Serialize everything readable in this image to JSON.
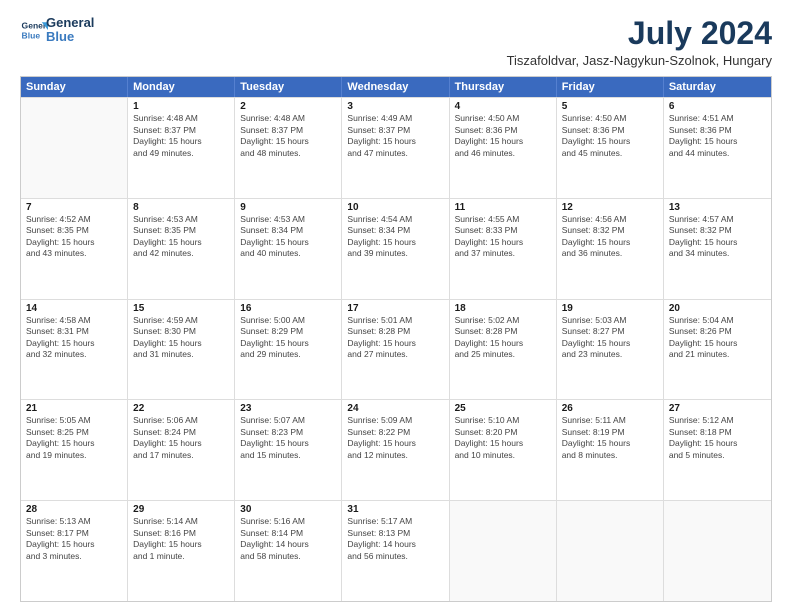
{
  "header": {
    "logo_line1": "General",
    "logo_line2": "Blue",
    "title": "July 2024",
    "subtitle": "Tiszafoldvar, Jasz-Nagykun-Szolnok, Hungary"
  },
  "weekdays": [
    "Sunday",
    "Monday",
    "Tuesday",
    "Wednesday",
    "Thursday",
    "Friday",
    "Saturday"
  ],
  "rows": [
    [
      {
        "day": "",
        "info": ""
      },
      {
        "day": "1",
        "info": "Sunrise: 4:48 AM\nSunset: 8:37 PM\nDaylight: 15 hours\nand 49 minutes."
      },
      {
        "day": "2",
        "info": "Sunrise: 4:48 AM\nSunset: 8:37 PM\nDaylight: 15 hours\nand 48 minutes."
      },
      {
        "day": "3",
        "info": "Sunrise: 4:49 AM\nSunset: 8:37 PM\nDaylight: 15 hours\nand 47 minutes."
      },
      {
        "day": "4",
        "info": "Sunrise: 4:50 AM\nSunset: 8:36 PM\nDaylight: 15 hours\nand 46 minutes."
      },
      {
        "day": "5",
        "info": "Sunrise: 4:50 AM\nSunset: 8:36 PM\nDaylight: 15 hours\nand 45 minutes."
      },
      {
        "day": "6",
        "info": "Sunrise: 4:51 AM\nSunset: 8:36 PM\nDaylight: 15 hours\nand 44 minutes."
      }
    ],
    [
      {
        "day": "7",
        "info": "Sunrise: 4:52 AM\nSunset: 8:35 PM\nDaylight: 15 hours\nand 43 minutes."
      },
      {
        "day": "8",
        "info": "Sunrise: 4:53 AM\nSunset: 8:35 PM\nDaylight: 15 hours\nand 42 minutes."
      },
      {
        "day": "9",
        "info": "Sunrise: 4:53 AM\nSunset: 8:34 PM\nDaylight: 15 hours\nand 40 minutes."
      },
      {
        "day": "10",
        "info": "Sunrise: 4:54 AM\nSunset: 8:34 PM\nDaylight: 15 hours\nand 39 minutes."
      },
      {
        "day": "11",
        "info": "Sunrise: 4:55 AM\nSunset: 8:33 PM\nDaylight: 15 hours\nand 37 minutes."
      },
      {
        "day": "12",
        "info": "Sunrise: 4:56 AM\nSunset: 8:32 PM\nDaylight: 15 hours\nand 36 minutes."
      },
      {
        "day": "13",
        "info": "Sunrise: 4:57 AM\nSunset: 8:32 PM\nDaylight: 15 hours\nand 34 minutes."
      }
    ],
    [
      {
        "day": "14",
        "info": "Sunrise: 4:58 AM\nSunset: 8:31 PM\nDaylight: 15 hours\nand 32 minutes."
      },
      {
        "day": "15",
        "info": "Sunrise: 4:59 AM\nSunset: 8:30 PM\nDaylight: 15 hours\nand 31 minutes."
      },
      {
        "day": "16",
        "info": "Sunrise: 5:00 AM\nSunset: 8:29 PM\nDaylight: 15 hours\nand 29 minutes."
      },
      {
        "day": "17",
        "info": "Sunrise: 5:01 AM\nSunset: 8:28 PM\nDaylight: 15 hours\nand 27 minutes."
      },
      {
        "day": "18",
        "info": "Sunrise: 5:02 AM\nSunset: 8:28 PM\nDaylight: 15 hours\nand 25 minutes."
      },
      {
        "day": "19",
        "info": "Sunrise: 5:03 AM\nSunset: 8:27 PM\nDaylight: 15 hours\nand 23 minutes."
      },
      {
        "day": "20",
        "info": "Sunrise: 5:04 AM\nSunset: 8:26 PM\nDaylight: 15 hours\nand 21 minutes."
      }
    ],
    [
      {
        "day": "21",
        "info": "Sunrise: 5:05 AM\nSunset: 8:25 PM\nDaylight: 15 hours\nand 19 minutes."
      },
      {
        "day": "22",
        "info": "Sunrise: 5:06 AM\nSunset: 8:24 PM\nDaylight: 15 hours\nand 17 minutes."
      },
      {
        "day": "23",
        "info": "Sunrise: 5:07 AM\nSunset: 8:23 PM\nDaylight: 15 hours\nand 15 minutes."
      },
      {
        "day": "24",
        "info": "Sunrise: 5:09 AM\nSunset: 8:22 PM\nDaylight: 15 hours\nand 12 minutes."
      },
      {
        "day": "25",
        "info": "Sunrise: 5:10 AM\nSunset: 8:20 PM\nDaylight: 15 hours\nand 10 minutes."
      },
      {
        "day": "26",
        "info": "Sunrise: 5:11 AM\nSunset: 8:19 PM\nDaylight: 15 hours\nand 8 minutes."
      },
      {
        "day": "27",
        "info": "Sunrise: 5:12 AM\nSunset: 8:18 PM\nDaylight: 15 hours\nand 5 minutes."
      }
    ],
    [
      {
        "day": "28",
        "info": "Sunrise: 5:13 AM\nSunset: 8:17 PM\nDaylight: 15 hours\nand 3 minutes."
      },
      {
        "day": "29",
        "info": "Sunrise: 5:14 AM\nSunset: 8:16 PM\nDaylight: 15 hours\nand 1 minute."
      },
      {
        "day": "30",
        "info": "Sunrise: 5:16 AM\nSunset: 8:14 PM\nDaylight: 14 hours\nand 58 minutes."
      },
      {
        "day": "31",
        "info": "Sunrise: 5:17 AM\nSunset: 8:13 PM\nDaylight: 14 hours\nand 56 minutes."
      },
      {
        "day": "",
        "info": ""
      },
      {
        "day": "",
        "info": ""
      },
      {
        "day": "",
        "info": ""
      }
    ]
  ]
}
